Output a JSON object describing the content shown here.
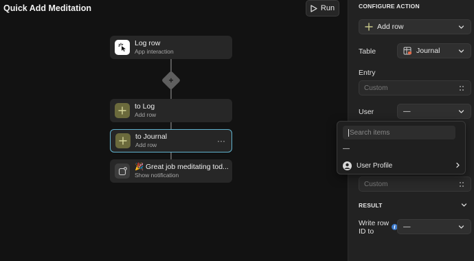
{
  "app": {
    "title": "Quick Add Meditation"
  },
  "toolbar": {
    "run_label": "Run"
  },
  "flow": {
    "nodes": [
      {
        "title": "Log row",
        "subtitle": "App interaction",
        "icon": "cursor-click-icon"
      },
      {
        "title": "to Log",
        "subtitle": "Add row",
        "icon": "plus-icon"
      },
      {
        "title": "to Journal",
        "subtitle": "Add row",
        "icon": "plus-icon",
        "menu": "···"
      },
      {
        "title": "🎉 Great job meditating tod...",
        "subtitle": "Show notification",
        "icon": "notification-icon"
      }
    ],
    "add_step": "+"
  },
  "panel": {
    "configure_title": "CONFIGURE ACTION",
    "action_select": "Add row",
    "table_label": "Table",
    "table_value": "Journal",
    "entry_label": "Entry",
    "entry_placeholder": "Custom",
    "user_label": "User",
    "user_value": "—",
    "custom2_placeholder": "Custom",
    "result_title": "RESULT",
    "write_row_label_1": "Write row",
    "write_row_label_2": "ID to",
    "write_row_value": "—",
    "info": "i"
  },
  "dropdown": {
    "search_placeholder": "Search items",
    "none_option": "—",
    "items": [
      {
        "label": "User Profile"
      }
    ]
  },
  "colors": {
    "selected_border": "#61b3cf",
    "olive_icon": "#6b6a3c",
    "add_icon": "#c9c98a"
  }
}
